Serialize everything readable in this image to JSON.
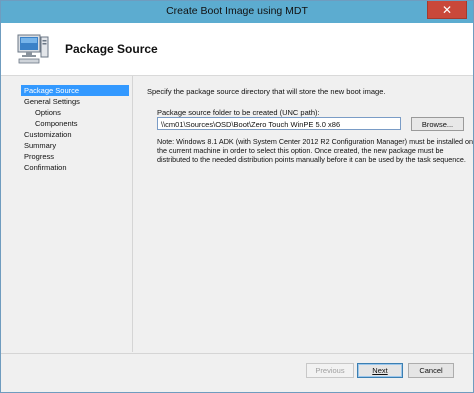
{
  "window": {
    "title": "Create Boot Image using MDT",
    "close_label": "✕"
  },
  "header": {
    "title": "Package Source",
    "icon": "computer-icon"
  },
  "nav": {
    "items": [
      {
        "label": "Package Source",
        "active": true
      },
      {
        "label": "General Settings"
      },
      {
        "label": "Options",
        "sub": true
      },
      {
        "label": "Components",
        "sub": true
      },
      {
        "label": "Customization"
      },
      {
        "label": "Summary"
      },
      {
        "label": "Progress"
      },
      {
        "label": "Confirmation"
      }
    ]
  },
  "main": {
    "description": "Specify the package source directory that will store the new boot image.",
    "field_label": "Package source folder to be created (UNC path):",
    "field_value": "\\\\cm01\\Sources\\OSD\\Boot\\Zero Touch WinPE 5.0 x86",
    "browse_label": "Browse...",
    "note": "Note: Windows 8.1 ADK (with System Center 2012 R2 Configuration Manager) must be installed on the current machine in order to select this option.  Once created, the new package must be distributed to the needed distribution points manually before it can be used by the task sequence."
  },
  "footer": {
    "previous_label": "Previous",
    "next_label": "Next",
    "cancel_label": "Cancel"
  },
  "colors": {
    "titlebar": "#5cacd0",
    "selection": "#3399ff",
    "close": "#c9483a"
  }
}
